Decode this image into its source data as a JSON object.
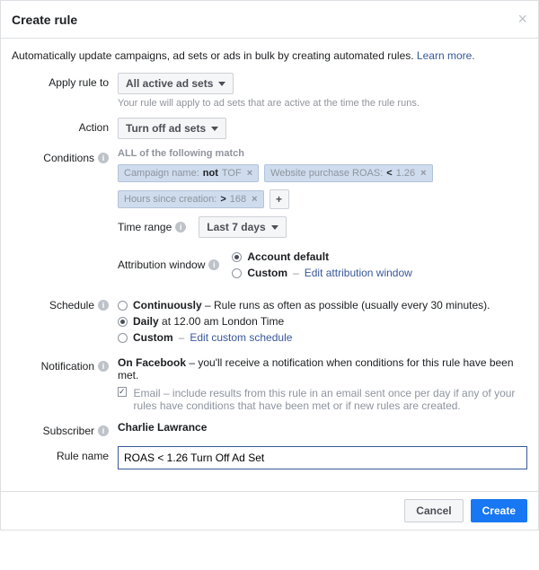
{
  "header": {
    "title": "Create rule"
  },
  "intro": {
    "text": "Automatically update campaigns, ad sets or ads in bulk by creating automated rules. ",
    "learn_more": "Learn more."
  },
  "apply": {
    "label": "Apply rule to",
    "value": "All active ad sets",
    "help": "Your rule will apply to ad sets that are active at the time the rule runs."
  },
  "action": {
    "label": "Action",
    "value": "Turn off ad sets"
  },
  "conditions": {
    "label": "Conditions",
    "sub": "ALL of the following match",
    "chips": [
      {
        "field": "Campaign name:",
        "op": "not",
        "val": "TOF"
      },
      {
        "field": "Website purchase ROAS:",
        "op": "<",
        "val": "1.26"
      },
      {
        "field": "Hours since creation:",
        "op": ">",
        "val": "168"
      }
    ],
    "time_range": {
      "label": "Time range",
      "value": "Last 7 days"
    },
    "attribution": {
      "label": "Attribution window",
      "opt_default": "Account default",
      "opt_custom": "Custom",
      "edit_link": "Edit attribution window"
    }
  },
  "schedule": {
    "label": "Schedule",
    "cont": {
      "title": "Continuously",
      "desc": " – Rule runs as often as possible (usually every 30 minutes)."
    },
    "daily": {
      "title": "Daily",
      "desc": " at 12.00 am London Time"
    },
    "custom": {
      "title": "Custom",
      "link": "Edit custom schedule"
    }
  },
  "notification": {
    "label": "Notification",
    "on_fb_title": "On Facebook",
    "on_fb_desc": " – you'll receive a notification when conditions for this rule have been met.",
    "email_label": "Email",
    "email_desc": " – include results from this rule in an email sent once per day if any of your rules have conditions that have been met or if new rules are created."
  },
  "subscriber": {
    "label": "Subscriber",
    "name": "Charlie Lawrance"
  },
  "rule_name": {
    "label": "Rule name",
    "value": "ROAS < 1.26 Turn Off Ad Set"
  },
  "footer": {
    "cancel": "Cancel",
    "create": "Create"
  }
}
